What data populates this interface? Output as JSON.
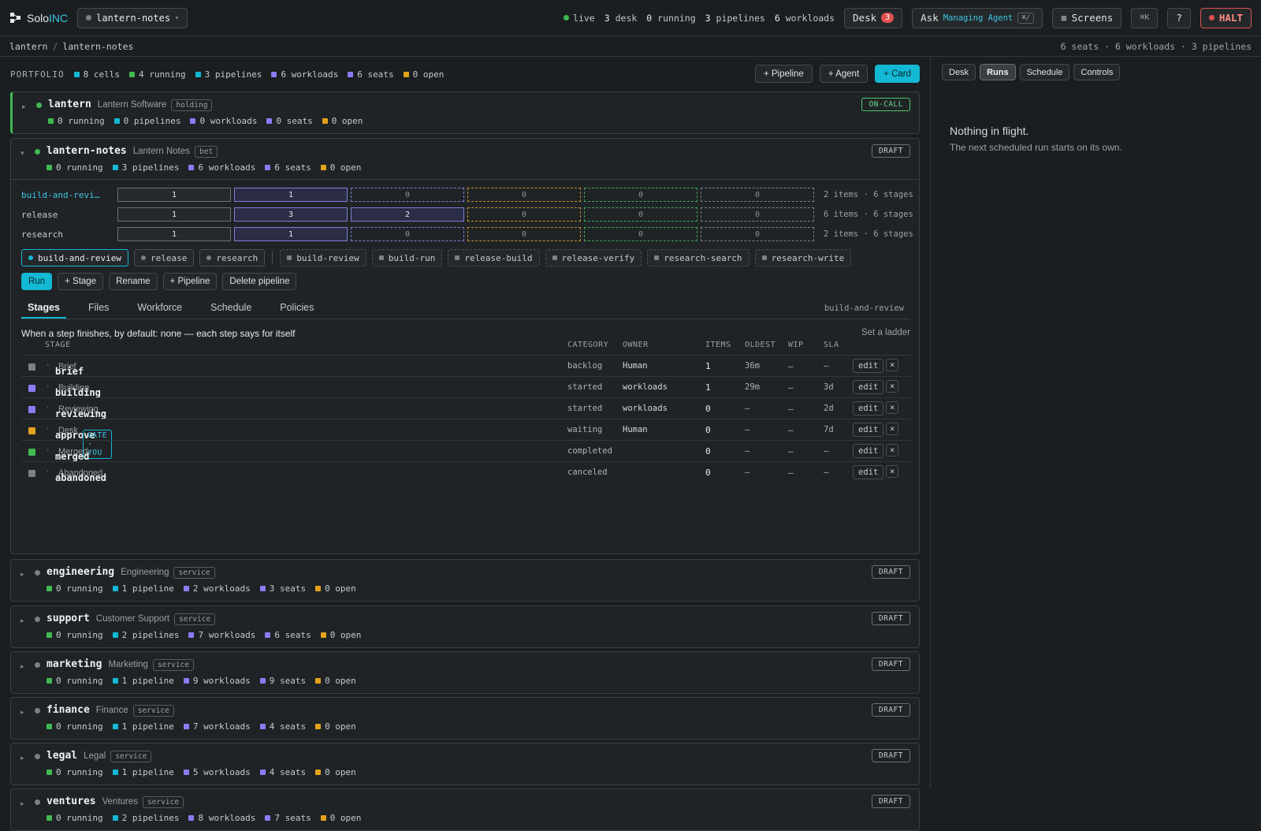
{
  "app": {
    "name_a": "Solo",
    "name_b": "INC"
  },
  "project": {
    "name": "lantern-notes"
  },
  "topstats": {
    "live": "live",
    "desk_n": "3",
    "desk_l": "desk",
    "running_n": "0",
    "running_l": "running",
    "pipelines_n": "3",
    "pipelines_l": "pipelines",
    "workloads_n": "6",
    "workloads_l": "workloads"
  },
  "toolbar": {
    "desk": "Desk",
    "desk_badge": "3",
    "ask": "Ask",
    "ask_agent": "Managing Agent",
    "ask_kbd": "⌘/",
    "screens": "Screens",
    "cmdk": "⌘K",
    "help": "?",
    "halt": "HALT"
  },
  "breadcrumb": {
    "root": "lantern",
    "current": "lantern-notes",
    "summary": "6 seats · 6 workloads · 3 pipelines"
  },
  "portfolio": {
    "label": "PORTFOLIO",
    "cells": "8 cells",
    "running": "4 running",
    "pipelines": "3 pipelines",
    "workloads": "6 workloads",
    "seats": "6 seats",
    "open": "0 open"
  },
  "portfolio_actions": {
    "pipeline": "+ Pipeline",
    "agent": "+ Agent",
    "card": "+ Card"
  },
  "colors": {
    "running": "#3fb950",
    "pipelines": "#12b8d4",
    "workloads": "#8b7cf6",
    "seats": "#8b7cf6",
    "open": "#e3a21a",
    "accent": "#12b8d4",
    "halt": "#d9534f"
  },
  "cells": [
    {
      "name": "lantern",
      "label": "Lantern Software",
      "tag": "holding",
      "status": "ON-CALL",
      "running": "0 running",
      "pipelines": "0 pipelines",
      "workloads": "0 workloads",
      "seats": "0 seats",
      "open": "0 open"
    },
    {
      "name": "lantern-notes",
      "label": "Lantern Notes",
      "tag": "bet",
      "status": "DRAFT",
      "running": "0 running",
      "pipelines": "3 pipelines",
      "workloads": "6 workloads",
      "seats": "6 seats",
      "open": "0 open"
    },
    {
      "name": "engineering",
      "label": "Engineering",
      "tag": "service",
      "status": "DRAFT",
      "running": "0 running",
      "pipelines": "1 pipeline",
      "workloads": "2 workloads",
      "seats": "3 seats",
      "open": "0 open"
    },
    {
      "name": "support",
      "label": "Customer Support",
      "tag": "service",
      "status": "DRAFT",
      "running": "0 running",
      "pipelines": "2 pipelines",
      "workloads": "7 workloads",
      "seats": "6 seats",
      "open": "0 open"
    },
    {
      "name": "marketing",
      "label": "Marketing",
      "tag": "service",
      "status": "DRAFT",
      "running": "0 running",
      "pipelines": "1 pipeline",
      "workloads": "9 workloads",
      "seats": "9 seats",
      "open": "0 open"
    },
    {
      "name": "finance",
      "label": "Finance",
      "tag": "service",
      "status": "DRAFT",
      "running": "0 running",
      "pipelines": "1 pipeline",
      "workloads": "7 workloads",
      "seats": "4 seats",
      "open": "0 open"
    },
    {
      "name": "legal",
      "label": "Legal",
      "tag": "service",
      "status": "DRAFT",
      "running": "0 running",
      "pipelines": "1 pipeline",
      "workloads": "5 workloads",
      "seats": "4 seats",
      "open": "0 open"
    },
    {
      "name": "ventures",
      "label": "Ventures",
      "tag": "service",
      "status": "DRAFT",
      "running": "0 running",
      "pipelines": "2 pipelines",
      "workloads": "8 workloads",
      "seats": "7 seats",
      "open": "0 open"
    }
  ],
  "pipelines": [
    {
      "name": "build-and-review",
      "counts": [
        "1",
        "1",
        "0",
        "0",
        "0",
        "0"
      ],
      "info": "2 items · 6 stages"
    },
    {
      "name": "release",
      "counts": [
        "1",
        "3",
        "2",
        "0",
        "0",
        "0"
      ],
      "info": "6 items · 6 stages"
    },
    {
      "name": "research",
      "counts": [
        "1",
        "1",
        "0",
        "0",
        "0",
        "0"
      ],
      "info": "2 items · 6 stages"
    }
  ],
  "chips": [
    "build-and-review",
    "release",
    "research"
  ],
  "workload_chips": [
    "build-review",
    "build-run",
    "release-build",
    "release-verify",
    "research-search",
    "research-write"
  ],
  "pipeline_actions": {
    "run": "Run",
    "stage": "+ Stage",
    "rename": "Rename",
    "pipeline": "+ Pipeline",
    "delete": "Delete pipeline"
  },
  "tabs": [
    "Stages",
    "Files",
    "Workforce",
    "Schedule",
    "Policies"
  ],
  "tabs_right": "build-and-review",
  "ladder": {
    "text": "When a step finishes, by default:  none — each step says for itself",
    "link": "Set a ladder"
  },
  "table_headers": {
    "stage": "STAGE",
    "category": "CATEGORY",
    "owner": "OWNER",
    "items": "ITEMS",
    "oldest": "OLDEST",
    "wip": "WIP",
    "sla": "SLA"
  },
  "stages": [
    {
      "key": "brief",
      "label": "Brief",
      "gate": "",
      "category": "backlog",
      "owner": "Human",
      "items": "1",
      "oldest": "36m",
      "wip": "—",
      "sla": "—",
      "color": "#7b8086"
    },
    {
      "key": "building",
      "label": "Building",
      "gate": "",
      "category": "started",
      "owner": "workloads",
      "items": "1",
      "oldest": "29m",
      "wip": "—",
      "sla": "3d",
      "color": "#8b7cf6"
    },
    {
      "key": "reviewing",
      "label": "Reviewing",
      "gate": "",
      "category": "started",
      "owner": "workloads",
      "items": "0",
      "oldest": "—",
      "wip": "—",
      "sla": "2d",
      "color": "#8b7cf6"
    },
    {
      "key": "approve",
      "label": "Desk",
      "gate": "GATE · YOU",
      "category": "waiting",
      "owner": "Human",
      "items": "0",
      "oldest": "—",
      "wip": "—",
      "sla": "7d",
      "color": "#e3a21a"
    },
    {
      "key": "merged",
      "label": "Merged",
      "gate": "",
      "category": "completed",
      "owner": "",
      "items": "0",
      "oldest": "—",
      "wip": "—",
      "sla": "—",
      "color": "#3fb950"
    },
    {
      "key": "abandoned",
      "label": "Abandoned",
      "gate": "",
      "category": "canceled",
      "owner": "",
      "items": "0",
      "oldest": "—",
      "wip": "—",
      "sla": "—",
      "color": "#7b8086"
    }
  ],
  "row_actions": {
    "edit": "edit",
    "remove": "×"
  },
  "side": {
    "tabs": [
      "Desk",
      "Runs",
      "Schedule",
      "Controls"
    ],
    "empty_title": "Nothing in flight.",
    "empty_sub": "The next scheduled run starts on its own."
  }
}
